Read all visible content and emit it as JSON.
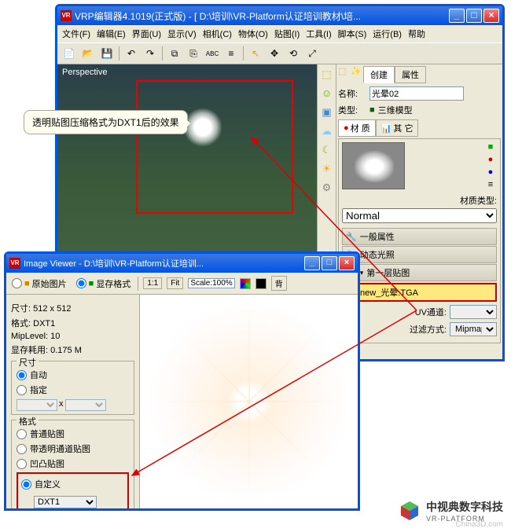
{
  "main": {
    "title": "VRP编辑器4.1019(正式版) - [ D:\\培训\\VR-Platform认证培训教材\\培...",
    "title_icon": "VR",
    "menu": [
      "文件(F)",
      "编辑(E)",
      "界面(U)",
      "显示(V)",
      "相机(C)",
      "物体(O)",
      "贴图(I)",
      "工具(I)",
      "脚本(S)",
      "运行(B)",
      "帮助"
    ],
    "viewport_label": "Perspective"
  },
  "props": {
    "tab_create": "创建",
    "tab_props": "属性",
    "name_label": "名称:",
    "name_value": "光晕02",
    "type_label": "类型:",
    "type_icon": "■",
    "type_value": "三维模型",
    "tab_material": "材 质",
    "tab_other": "其 它",
    "mat_type_label": "材质类型:",
    "mat_type_value": "Normal",
    "sections": {
      "general": "一般属性",
      "lighting": "动态光照",
      "layer1": "第一层贴图"
    },
    "tex_name": "new_光晕.TGA",
    "uv_label": "UV通道:",
    "filter_label": "过滤方式:",
    "filter_value": "Mipmap"
  },
  "iv": {
    "title": "Image Viewer - D:\\培训\\VR-Platform认证培训...",
    "title_icon": "VR",
    "tab_orig": "原始图片",
    "tab_mem": "显存格式",
    "btn_11": "1:1",
    "btn_fit": "Fit",
    "scale_label": "Scale:100%",
    "btn_bg": "背",
    "info_size_label": "尺寸:",
    "info_size": "512 x 512",
    "info_fmt_label": "格式:",
    "info_fmt": "DXT1",
    "info_mip_label": "MipLevel:",
    "info_mip": "10",
    "info_mem_label": "显存耗用:",
    "info_mem": "0.175 M",
    "grp_size": "尺寸",
    "radio_auto": "自动",
    "radio_fixed": "指定",
    "grp_fmt": "格式",
    "radio_normal": "普通贴图",
    "radio_alpha": "带透明通道贴图",
    "radio_bump": "凹凸贴图",
    "radio_custom": "自定义",
    "custom_fmt": "DXT1"
  },
  "tooltip": "透明贴图压缩格式为DXT1后的效果",
  "logo": {
    "main": "中视典数字科技",
    "sub": "VR-PLATFORM"
  },
  "watermark": "China3D.com"
}
